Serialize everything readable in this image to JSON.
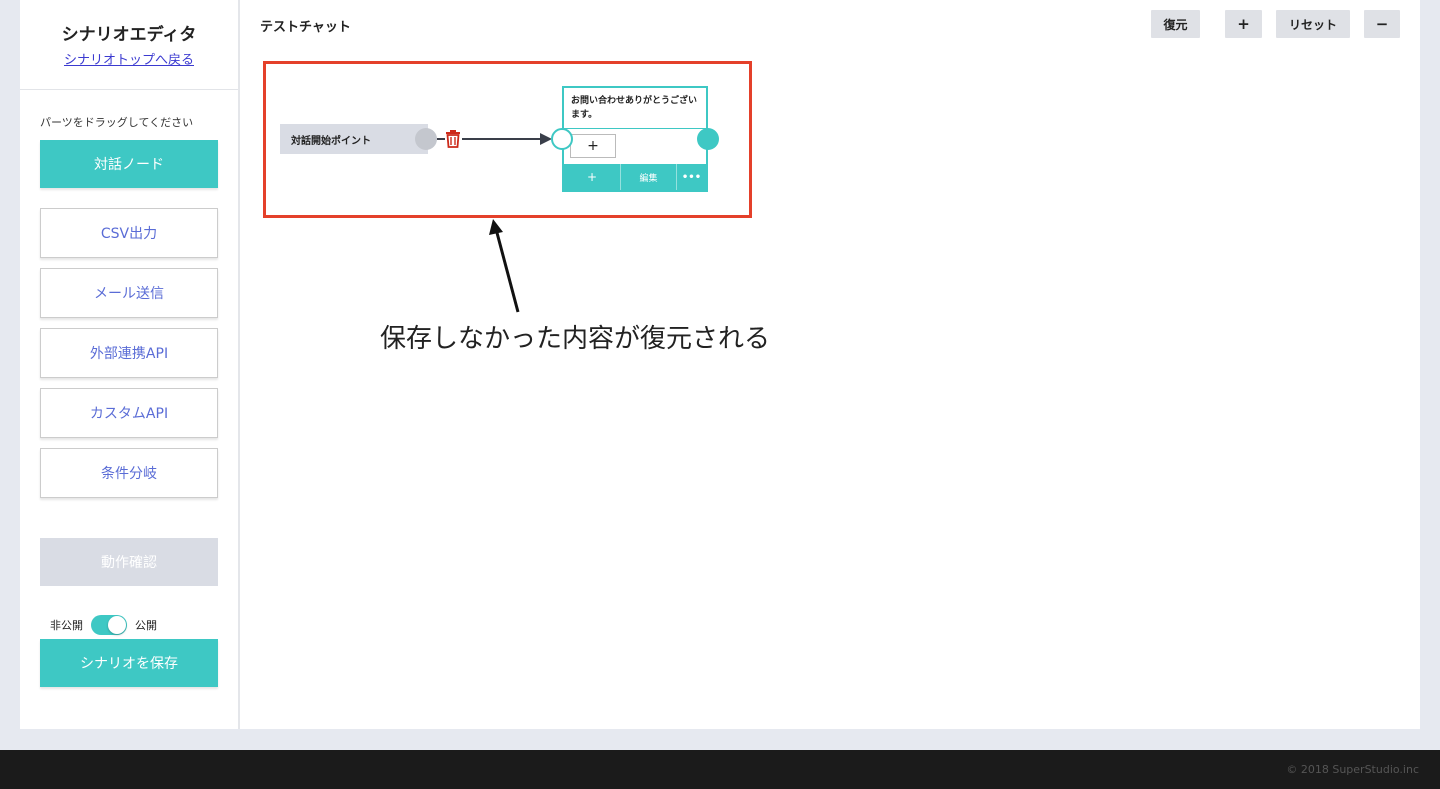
{
  "sidebar": {
    "title": "シナリオエディタ",
    "back_link": "シナリオトップへ戻る",
    "instruction": "パーツをドラッグしてください",
    "parts": [
      "対話ノード",
      "CSV出力",
      "メール送信",
      "外部連携API",
      "カスタムAPI",
      "条件分岐"
    ],
    "test_button": "動作確認",
    "toggle": {
      "off_label": "非公開",
      "on_label": "公開",
      "state": "on"
    },
    "save_button": "シナリオを保存"
  },
  "canvas": {
    "title": "テストチャット",
    "toolbar": {
      "restore": "復元",
      "zoom_in": "+",
      "reset": "リセット",
      "zoom_out": "−"
    },
    "start_node": {
      "label": "対話開始ポイント"
    },
    "message_node": {
      "text": "お問い合わせありがとうございます。",
      "add_choice": "+",
      "footer_add": "+",
      "footer_edit": "編集",
      "footer_more": "•••"
    }
  },
  "annotation": {
    "text": "保存しなかった内容が復元される",
    "highlight_color": "#e4402a"
  },
  "footer": {
    "copyright": "© 2018 SuperStudio.inc"
  },
  "colors": {
    "accent": "#3ec8c4",
    "link": "#3b3ad0",
    "part_text": "#5a6cd6",
    "delete": "#cc2a1a"
  },
  "icons": [
    "trash-icon",
    "arrow-icon"
  ]
}
